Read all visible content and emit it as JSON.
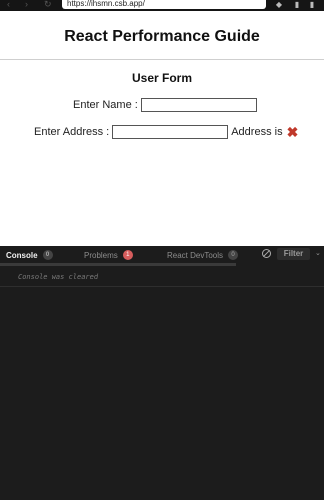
{
  "browser": {
    "url": "https://ihsmn.csb.app/",
    "back_icon": "‹",
    "forward_icon": "›",
    "reload_icon": "↻"
  },
  "page": {
    "title": "React Performance Guide",
    "form_title": "User Form",
    "name_label": "Enter Name :",
    "name_value": "",
    "address_label": "Enter Address :",
    "address_value": "",
    "address_status": "Address is",
    "status_icon": "✖",
    "status_color": "#c0392b"
  },
  "devtools": {
    "tabs": [
      {
        "label": "Console",
        "badge": "0"
      },
      {
        "label": "Problems",
        "badge": "1"
      },
      {
        "label": "React DevTools",
        "badge": "0"
      }
    ],
    "filter_label": "Filter",
    "chevron": "⌄",
    "console_message": "Console was cleared"
  }
}
